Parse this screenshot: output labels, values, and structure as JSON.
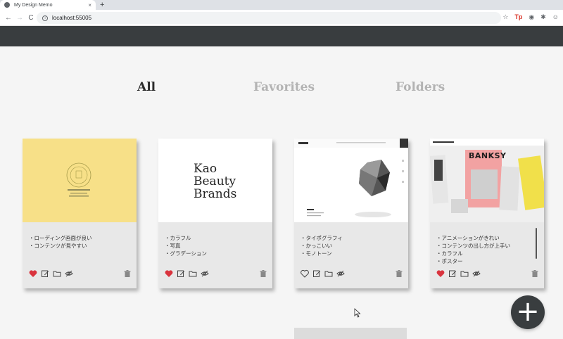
{
  "browser": {
    "tab_title": "My Design Memo",
    "tab_close": "×",
    "new_tab": "+",
    "url": "localhost:55005",
    "back": "←",
    "forward": "→",
    "reload": "C"
  },
  "nav_tabs": [
    "All",
    "Favorites",
    "Folders"
  ],
  "active_tab": "All",
  "cards": [
    {
      "notes": [
        "ローディング画面が良い",
        "コンテンツが見やすい"
      ],
      "favorite": true,
      "thumb_color": "#f7e088"
    },
    {
      "thumb_text": [
        "Kao",
        "Beauty",
        "Brands"
      ],
      "notes": [
        "カラフル",
        "写真",
        "グラデーション"
      ],
      "favorite": true,
      "thumb_color": "#ffffff"
    },
    {
      "notes": [
        "タイポグラフィ",
        "かっこいい",
        "モノトーン"
      ],
      "favorite": false,
      "thumb_color": "#ffffff"
    },
    {
      "thumb_text": [
        "BANKSY"
      ],
      "notes": [
        "アニメーションがきれい",
        "コンテンツの出し方が上手い",
        "カラフル",
        "ポスター"
      ],
      "favorite": true,
      "thumb_color": "#efefef"
    }
  ],
  "fab_label": "+",
  "colors": {
    "header": "#393d3f",
    "heart": "#d9343e",
    "accent_yellow": "#f7e088"
  }
}
